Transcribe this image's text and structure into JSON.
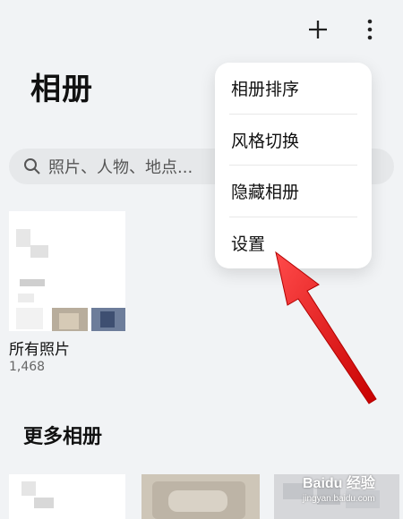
{
  "header": {
    "title": "相册"
  },
  "search": {
    "placeholder": "照片、人物、地点..."
  },
  "album": {
    "name": "所有照片",
    "count": "1,468"
  },
  "section": {
    "title": "更多相册"
  },
  "menu": {
    "items": [
      {
        "label": "相册排序"
      },
      {
        "label": "风格切换"
      },
      {
        "label": "隐藏相册"
      },
      {
        "label": "设置"
      }
    ]
  },
  "watermark": {
    "main": "Baidu 经验",
    "sub": "jingyan.baidu.com"
  },
  "colors": {
    "accent_red": "#e41414",
    "background": "#f1f3f5"
  },
  "icons": {
    "add": "add-icon",
    "more": "more-vert-icon",
    "search": "search-icon"
  }
}
